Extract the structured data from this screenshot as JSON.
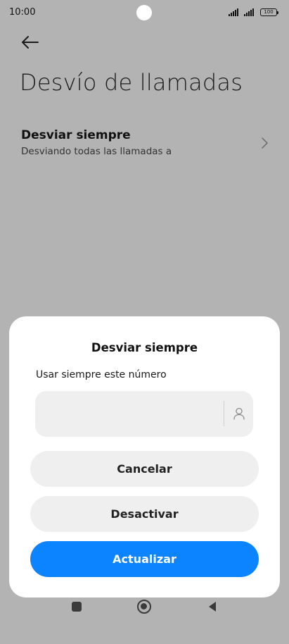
{
  "status_bar": {
    "time": "10:00",
    "battery": "100"
  },
  "page": {
    "title": "Desvío de llamadas",
    "setting": {
      "title": "Desviar siempre",
      "subtitle": "Desviando todas las llamadas a"
    }
  },
  "dialog": {
    "title": "Desviar siempre",
    "field_label": "Usar siempre este número",
    "field_value": "",
    "cancel_label": "Cancelar",
    "deactivate_label": "Desactivar",
    "update_label": "Actualizar"
  },
  "colors": {
    "scrim": "#b3b3b3",
    "accent": "#0d84ff",
    "button_grey": "#efefef",
    "dialog_bg": "#ffffff"
  },
  "icons": {
    "back": "back-arrow-icon",
    "chevron": "chevron-right-icon",
    "contact": "contact-person-icon",
    "nav_recents": "recents-square-icon",
    "nav_home": "home-circle-icon",
    "nav_back": "back-triangle-icon"
  }
}
